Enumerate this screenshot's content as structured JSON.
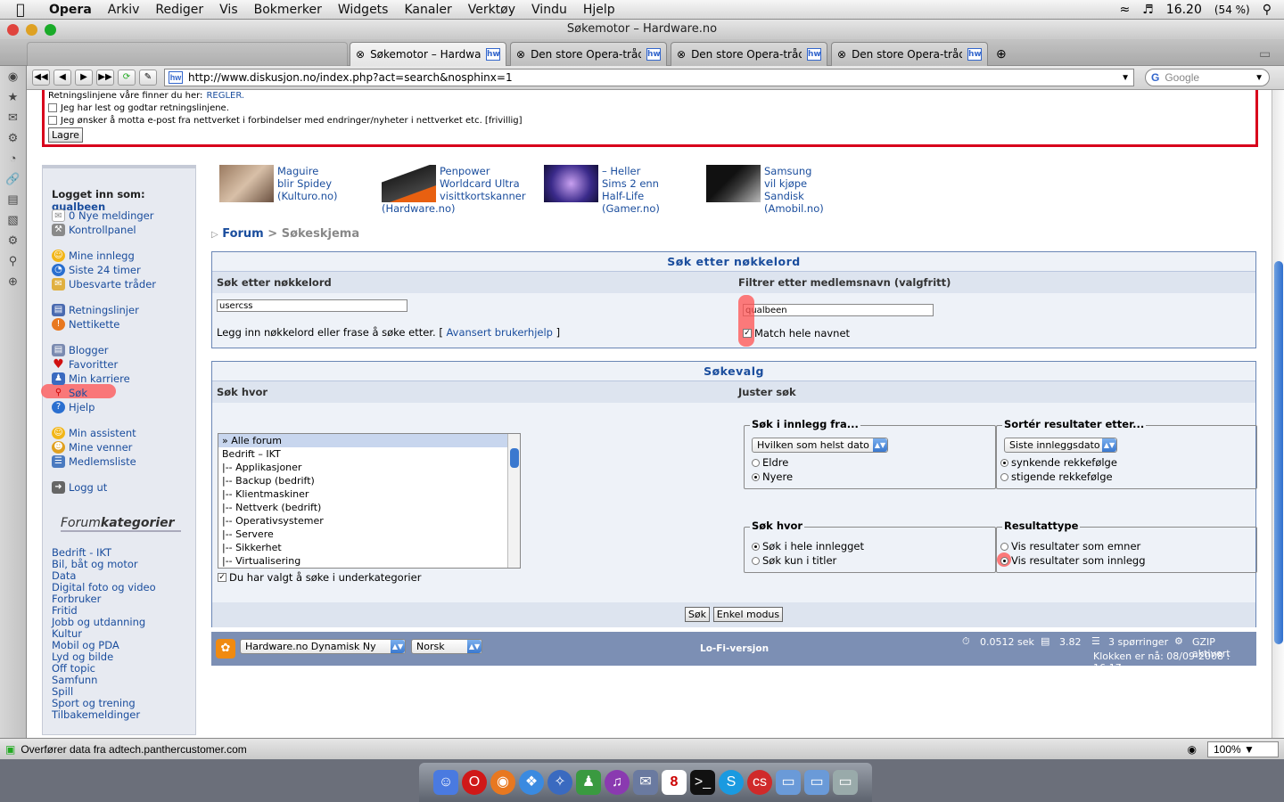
{
  "menubar": {
    "app": "Opera",
    "items": [
      "Arkiv",
      "Rediger",
      "Vis",
      "Bokmerker",
      "Widgets",
      "Kanaler",
      "Verktøy",
      "Vindu",
      "Hjelp"
    ],
    "time": "16.20",
    "battery": "(54 %)"
  },
  "window": {
    "title": "Søkemotor – Hardware.no"
  },
  "tabs": [
    {
      "label": "Søkemotor – Hardware..."
    },
    {
      "label": "Den store Opera-tråd..."
    },
    {
      "label": "Den store Opera-tråd..."
    },
    {
      "label": "Den store Opera-tråd..."
    }
  ],
  "address": {
    "url": "http://www.diskusjon.no/index.php?act=search&nosphinx=1",
    "search_placeholder": "Google"
  },
  "top": {
    "rules_text": "Retningslinjene våre finner du her:",
    "rules_link": "REGLER.",
    "check1": "Jeg har lest og godtar retningslinjene.",
    "check2": "Jeg ønsker å motta e-post fra nettverket i forbindelser med endringer/nyheter i nettverket etc. [frivillig]",
    "save": "Lagre"
  },
  "sidebar": {
    "logged_label": "Logget inn som:",
    "user": "qualbeen",
    "links": [
      {
        "label": "0 Nye meldinger",
        "icon": "envelope-icon"
      },
      {
        "label": "Kontrollpanel",
        "icon": "tools-icon"
      },
      {
        "label": "Mine innlegg",
        "icon": "smiley-icon"
      },
      {
        "label": "Siste 24 timer",
        "icon": "clock-icon"
      },
      {
        "label": "Ubesvarte tråder",
        "icon": "envelope-open-icon"
      },
      {
        "label": "Retningslinjer",
        "icon": "book-icon"
      },
      {
        "label": "Nettikette",
        "icon": "warning-icon"
      },
      {
        "label": "Blogger",
        "icon": "blog-icon"
      },
      {
        "label": "Favoritter",
        "icon": "heart-icon"
      },
      {
        "label": "Min karriere",
        "icon": "people-icon"
      },
      {
        "label": "Søk",
        "icon": "magnifier-icon"
      },
      {
        "label": "Hjelp",
        "icon": "help-icon"
      },
      {
        "label": "Min assistent",
        "icon": "smiley-icon"
      },
      {
        "label": "Mine venner",
        "icon": "friends-icon"
      },
      {
        "label": "Medlemsliste",
        "icon": "list-icon"
      },
      {
        "label": "Logg ut",
        "icon": "logout-icon"
      }
    ],
    "forum_head_a": "Forum",
    "forum_head_b": "kategorier",
    "categories": [
      "Bedrift - IKT",
      "Bil, båt og motor",
      "Data",
      "Digital foto og video",
      "Forbruker",
      "Fritid",
      "Jobb og utdanning",
      "Kultur",
      "Mobil og PDA",
      "Lyd og bilde",
      "Off topic",
      "Samfunn",
      "Spill",
      "Sport og trening",
      "Tilbakemeldinger"
    ]
  },
  "news": [
    {
      "l1": "Maguire blir Spidey",
      "l2": "(Kulturo.no)"
    },
    {
      "l1": "Penpower",
      "l2": "Worldcard Ultra",
      "l3": "visittkortskanner",
      "l4": "(Hardware.no)"
    },
    {
      "l1": "– Heller Sims 2 enn",
      "l2": "Half-Life",
      "l3": "(Gamer.no)"
    },
    {
      "l1": "Samsung vil kjøpe",
      "l2": "Sandisk",
      "l3": "(Amobil.no)"
    }
  ],
  "breadcrumb": {
    "forum": "Forum",
    "sep": ">",
    "current": "Søkeskjema"
  },
  "keyword": {
    "header": "Søk etter nøkkelord",
    "col1": "Søk etter nøkkelord",
    "col2": "Filtrer etter medlemsnavn (valgfritt)",
    "value": "usercss",
    "member": "qualbeen",
    "hint": "Legg inn nøkkelord eller frase å søke etter. [",
    "help_link": "Avansert brukerhjelp",
    "hint_end": "]",
    "match": "Match hele navnet"
  },
  "options": {
    "header": "Søkevalg",
    "col1": "Søk hvor",
    "col2": "Juster søk",
    "forums": [
      "» Alle forum",
      "Bedrift – IKT",
      "|-- Applikasjoner",
      "|-- Backup (bedrift)",
      "|-- Klientmaskiner",
      "|-- Nettverk (bedrift)",
      "|-- Operativsystemer",
      "|-- Servere",
      "|-- Sikkerhet",
      "|-- Virtualisering"
    ],
    "subcats": "Du har valgt å søke i underkategorier",
    "from_legend": "Søk i innlegg fra...",
    "from_select": "Hvilken som helst dato",
    "older": "Eldre",
    "newer": "Nyere",
    "sort_legend": "Sortér resultater etter...",
    "sort_select": "Siste innleggsdato",
    "desc": "synkende rekkefølge",
    "asc": "stigende rekkefølge",
    "where_legend": "Søk hvor",
    "where_all": "Søk i hele innlegget",
    "where_titles": "Søk kun i titler",
    "type_legend": "Resultattype",
    "type_topics": "Vis resultater som emner",
    "type_posts": "Vis resultater som innlegg",
    "search_btn": "Søk",
    "simple_btn": "Enkel modus"
  },
  "footer": {
    "theme": "Hardware.no Dynamisk Ny",
    "lang": "Norsk",
    "lofi": "Lo-Fi-versjon",
    "time": "0.0512 sek",
    "load": "3.82",
    "queries": "3 spørringer",
    "gzip": "GZIP aktivert",
    "clock": "Klokken er nå: 08/09-2008 : 16:17"
  },
  "status": {
    "text": "Overfører data fra adtech.panthercustomer.com",
    "zoom": "100%"
  },
  "colors": {
    "accent": "#1a4d9d",
    "red": "#d8001b",
    "footer": "#7c8fb4"
  }
}
